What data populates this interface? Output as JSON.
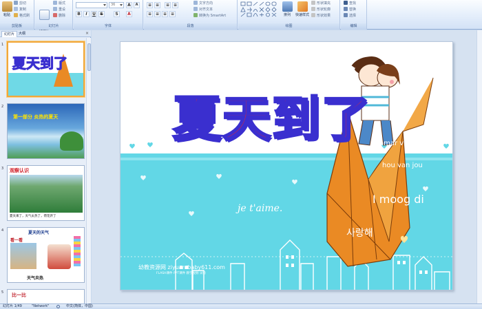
{
  "ribbon": {
    "clipboard": {
      "paste": "粘贴",
      "cut": "剪切",
      "copy": "复制",
      "format_painter": "格式刷",
      "group": "剪贴板"
    },
    "slides": {
      "new_slide": "新建\n幻灯片",
      "layout": "版式",
      "reset": "重设",
      "delete": "删除",
      "group": "幻灯片"
    },
    "font": {
      "size": "36",
      "group": "字体"
    },
    "paragraph": {
      "text_direction": "文字方向",
      "align_text": "对齐文本",
      "smartart": "转换为 SmartArt",
      "group": "段落"
    },
    "drawing": {
      "arrange": "排列",
      "quick_styles": "快速样式",
      "fill": "形状填充",
      "outline": "形状轮廓",
      "effects": "形状效果",
      "group": "绘图"
    },
    "editing": {
      "find": "查找",
      "replace": "替换",
      "select": "选择",
      "group": "编辑"
    }
  },
  "panel": {
    "tab_slides": "幻灯片",
    "tab_outline": "大纲",
    "thumbs": [
      {
        "num": "1",
        "title": "夏天到了"
      },
      {
        "num": "2",
        "title": "第一部分  炎热的夏天"
      },
      {
        "num": "3",
        "title": "观察认识",
        "caption": "夏天来了，天气炎热了，荷花开了"
      },
      {
        "num": "4",
        "title": "夏天的天气",
        "tag": "看一看",
        "caption": "天气炎热"
      },
      {
        "num": "5",
        "title": "比一比"
      }
    ]
  },
  "slide": {
    "title": "夏天到了",
    "crane_lines": [
      "amar vin",
      "hou van jou",
      "I moog di",
      "사랑해"
    ],
    "script_text": "je t'aime.",
    "watermark": "幼教资源网 ziyuan.baby611.com",
    "watermark_sub": "FLASH课件  PPT课件  教学视频  试卷"
  },
  "status": {
    "slide_pos": "幻灯片 1/49",
    "theme": "\"Network\"",
    "lang": "中文(简体，中国)"
  },
  "colors": {
    "title_fill": "#e8262b",
    "title_stroke": "#3a2fcf",
    "sky": "#5fd6e6",
    "crane": "#e98a25"
  }
}
